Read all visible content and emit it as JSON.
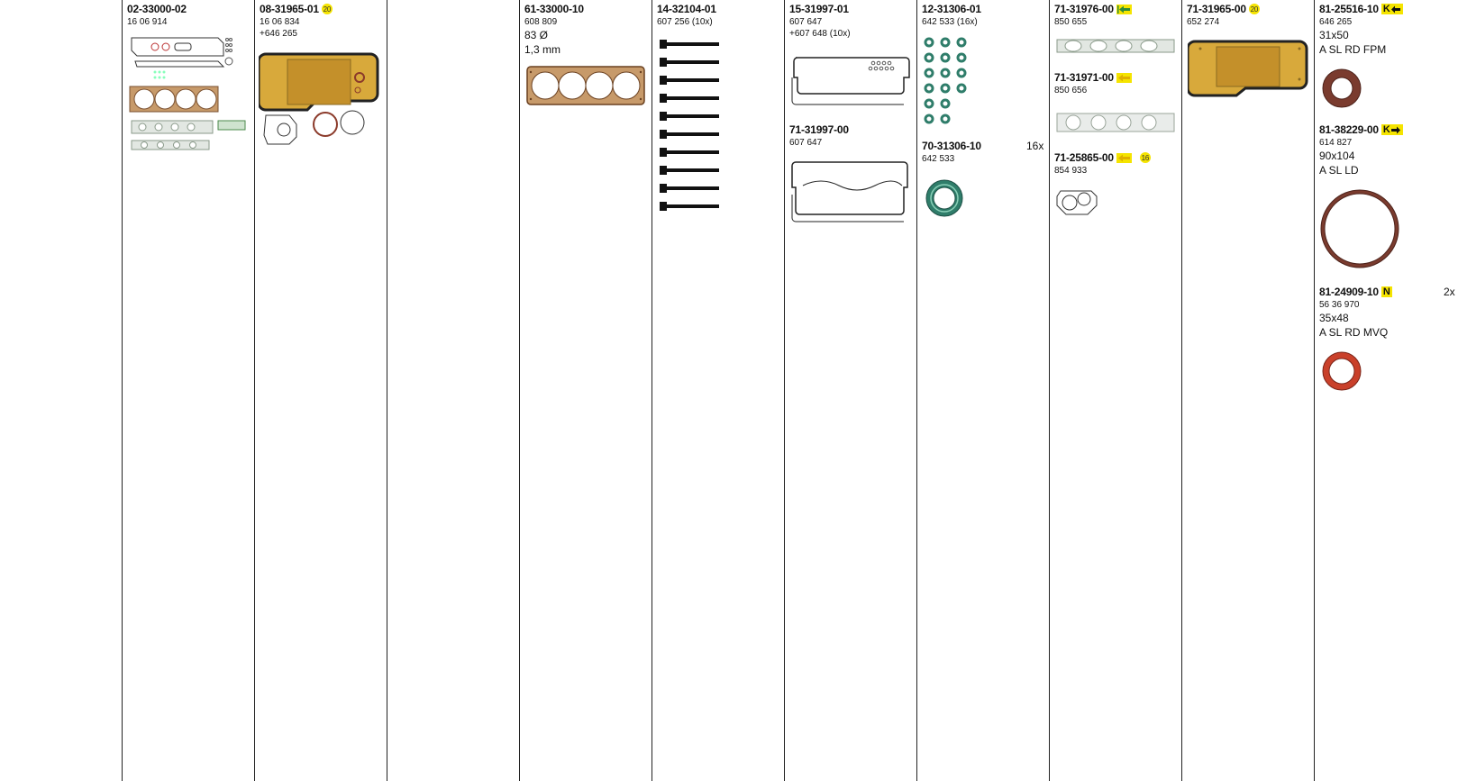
{
  "columns": [
    {
      "items": [
        {
          "part_no": "02-33000-02",
          "lines": [
            "16 06 914"
          ]
        }
      ]
    },
    {
      "items": [
        {
          "part_no": "08-31965-01",
          "badge": "20",
          "lines": [
            "16 06 834",
            "+646 265"
          ]
        }
      ]
    },
    {
      "items": []
    },
    {
      "items": [
        {
          "part_no": "61-33000-10",
          "lines": [
            "608 809"
          ],
          "big_lines": [
            "83 Ø",
            "1,3 mm"
          ]
        }
      ]
    },
    {
      "items": [
        {
          "part_no": "14-32104-01",
          "lines": [
            "607 256 (10x)"
          ]
        }
      ]
    },
    {
      "items": [
        {
          "part_no": "15-31997-01",
          "lines": [
            "607 647",
            "+607 648 (10x)"
          ]
        },
        {
          "part_no": "71-31997-00",
          "lines": [
            "607 647"
          ]
        }
      ]
    },
    {
      "items": [
        {
          "part_no": "12-31306-01",
          "lines": [
            "642 533 (16x)"
          ]
        },
        {
          "part_no": "70-31306-10",
          "lines": [
            "642 533"
          ],
          "qty": "16x"
        }
      ]
    },
    {
      "items": [
        {
          "part_no": "71-31976-00",
          "icon": "arrow-left-bar-icon",
          "lines": [
            "850 655"
          ]
        },
        {
          "part_no": "71-31971-00",
          "icon": "arrow-left-icon",
          "lines": [
            "850 656"
          ]
        },
        {
          "part_no": "71-25865-00",
          "icon": "arrow-left-icon",
          "badge": "16",
          "lines": [
            "854 933"
          ]
        }
      ]
    },
    {
      "items": [
        {
          "part_no": "71-31965-00",
          "badge": "20",
          "lines": [
            "652 274"
          ]
        }
      ]
    },
    {
      "items": [
        {
          "part_no": "81-25516-10",
          "tag": "K",
          "icon": "arrow-left-icon",
          "lines": [
            "646 265"
          ],
          "big_lines": [
            "31x50",
            "A SL RD FPM"
          ]
        },
        {
          "part_no": "81-38229-00",
          "tag": "K",
          "icon": "arrow-right-icon",
          "lines": [
            "614 827"
          ],
          "big_lines": [
            "90x104",
            "A SL LD"
          ]
        },
        {
          "part_no": "81-24909-10",
          "tag": "N",
          "lines": [
            "56 36 970"
          ],
          "big_lines": [
            "35x48",
            "A SL RD MVQ"
          ],
          "qty": "2x"
        }
      ]
    }
  ],
  "colors": {
    "highlight": "#f5e400",
    "arrow": "#2e8b3a",
    "arrow_alt": "#e0b000",
    "gasket_copper": "#b9895a",
    "seal_green": "#2f7d6a",
    "seal_brown": "#7a3b2e"
  }
}
